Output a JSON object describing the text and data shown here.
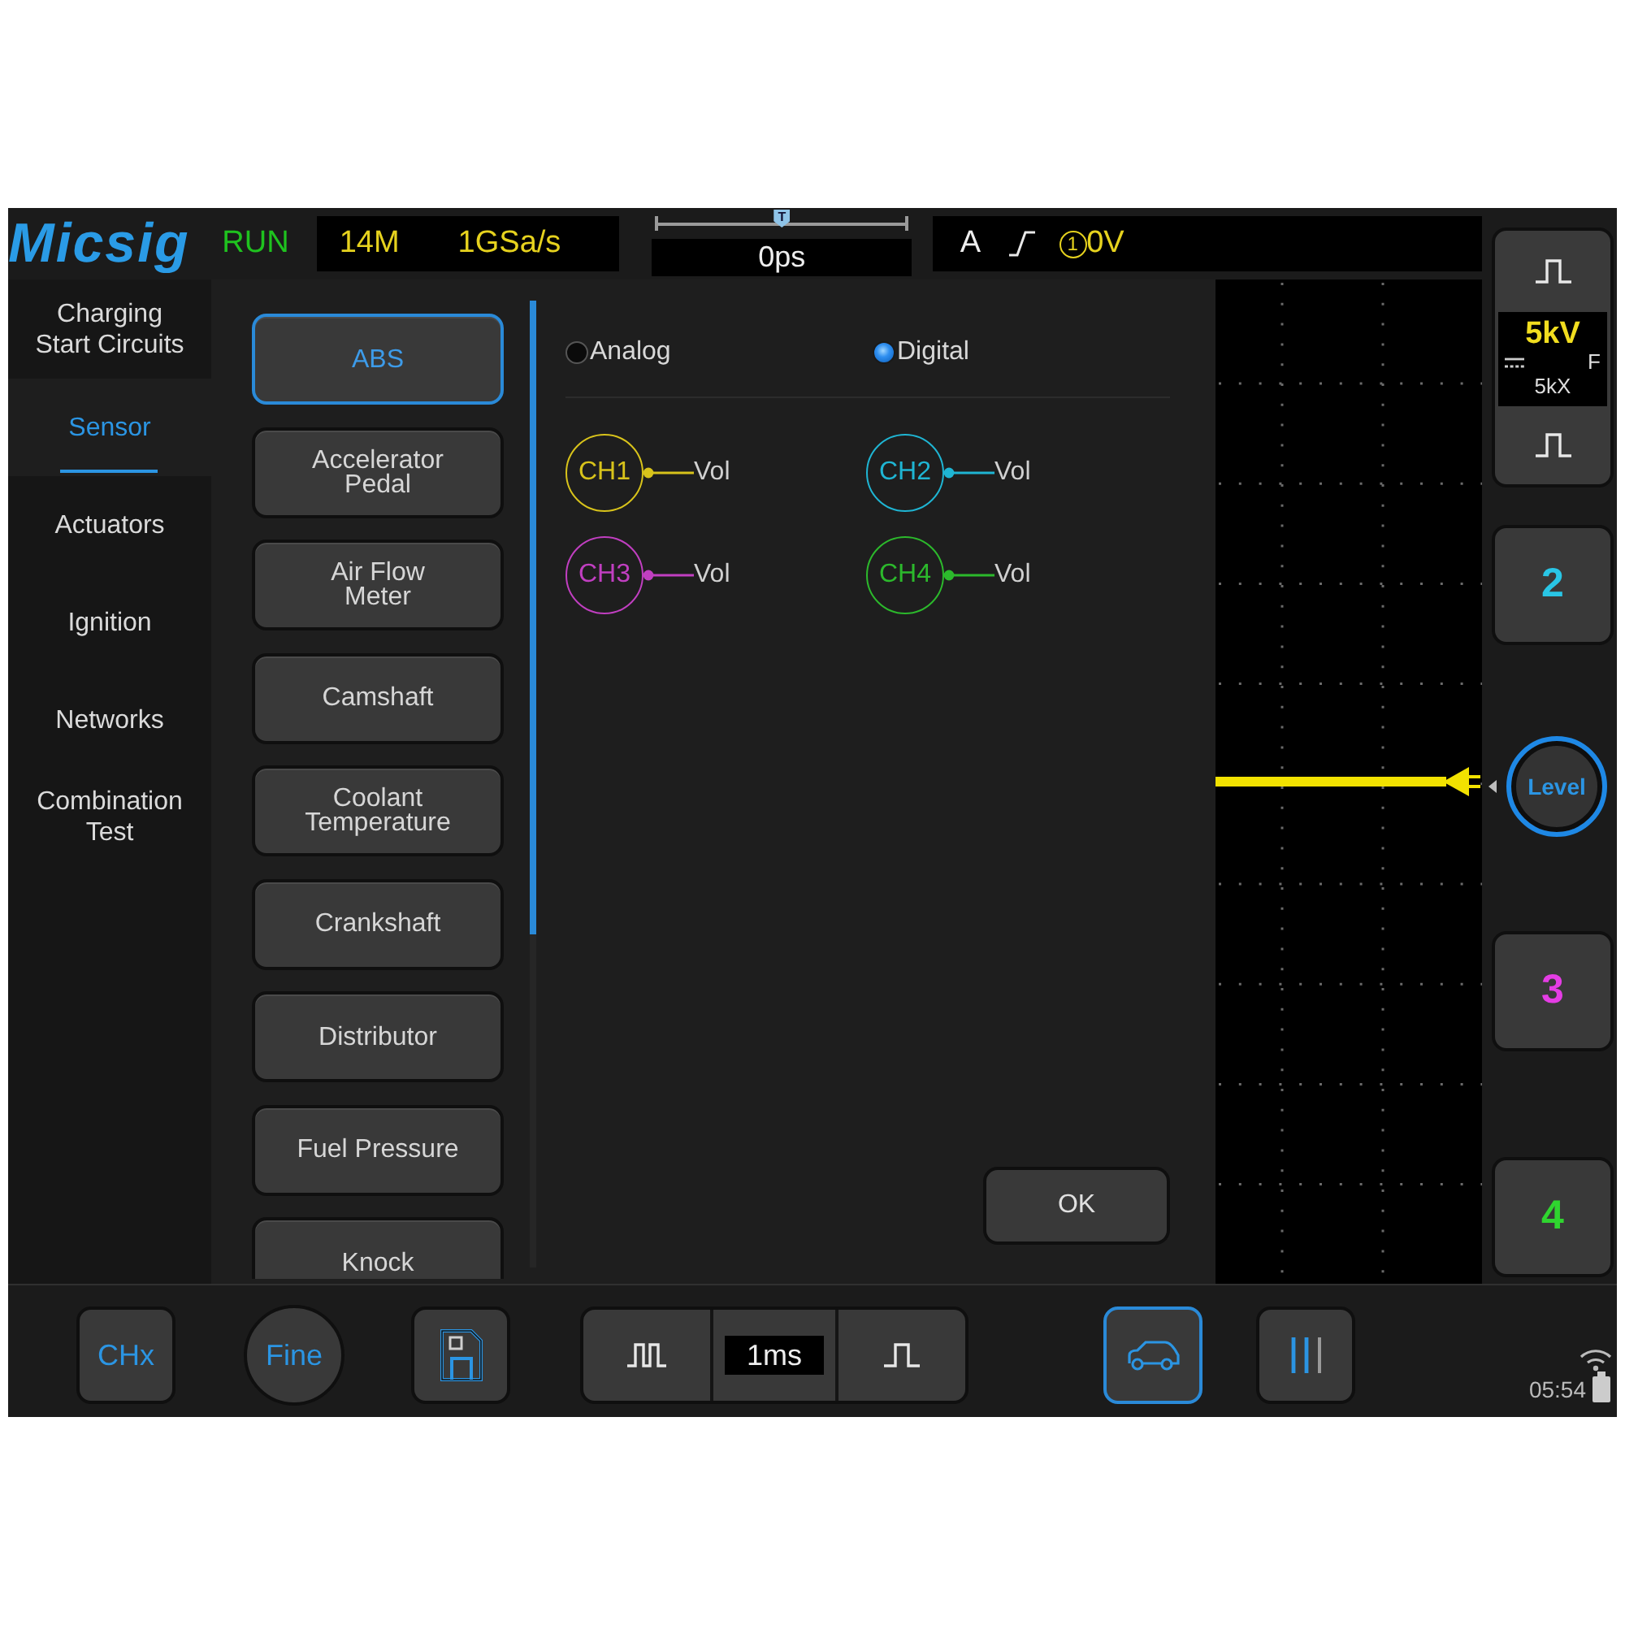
{
  "top_bar": {
    "logo": "Micsig",
    "run_state": "RUN",
    "memory_depth": "14M",
    "sample_rate": "1GSa/s",
    "time_position": {
      "marker": "T",
      "level": 0.5
    },
    "time_offset": "0ps",
    "trigger": {
      "source": "A",
      "channel": "1",
      "threshold": "0V"
    }
  },
  "categories": [
    {
      "label": "Charging\nStart Circuits",
      "selected": false
    },
    {
      "label": "Sensor",
      "selected": true
    },
    {
      "label": "Actuators",
      "selected": false
    },
    {
      "label": "Ignition",
      "selected": false
    },
    {
      "label": "Networks",
      "selected": false
    },
    {
      "label": "Combination\nTest",
      "selected": false
    }
  ],
  "sensors": [
    {
      "label": "ABS",
      "selected": true
    },
    {
      "label": "Accelerator\nPedal",
      "selected": false
    },
    {
      "label": "Air Flow\nMeter",
      "selected": false
    },
    {
      "label": "Camshaft",
      "selected": false
    },
    {
      "label": "Coolant\nTemperature",
      "selected": false
    },
    {
      "label": "Crankshaft",
      "selected": false
    },
    {
      "label": "Distributor",
      "selected": false
    },
    {
      "label": "Fuel Pressure",
      "selected": false
    },
    {
      "label": "Knock",
      "selected": false
    }
  ],
  "signal_modes": [
    {
      "label": "Analog",
      "selected": false
    },
    {
      "label": "Digital",
      "selected": true
    }
  ],
  "channels": [
    {
      "label": "CH1",
      "color": "#d8c31b",
      "value": "Vol"
    },
    {
      "label": "CH2",
      "color": "#1fb5d3",
      "value": "Vol"
    },
    {
      "label": "CH3",
      "color": "#c13fc1",
      "value": "Vol"
    },
    {
      "label": "CH4",
      "color": "#2cb92c",
      "value": "Vol"
    }
  ],
  "ok_button": "OK",
  "channel_scale": {
    "value": "5kV",
    "coupling": "F",
    "probe": "5kX"
  },
  "side_buttons": [
    {
      "kind": "channel",
      "label": "2",
      "color": "#29c6e6"
    },
    {
      "kind": "level",
      "label": "Level"
    },
    {
      "kind": "channel",
      "label": "3",
      "color": "#e43de4"
    },
    {
      "kind": "channel",
      "label": "4",
      "color": "#2fd52f"
    }
  ],
  "bottom_bar": {
    "buttons": [
      {
        "kind": "square",
        "label": "CHx",
        "selected": false
      },
      {
        "kind": "round",
        "label": "Fine",
        "selected": false
      },
      {
        "kind": "save",
        "selected": false
      }
    ],
    "timebase": "1ms",
    "tools": [
      {
        "kind": "car",
        "selected": true
      },
      {
        "kind": "bars",
        "selected": false
      }
    ],
    "clock": "05:54"
  }
}
